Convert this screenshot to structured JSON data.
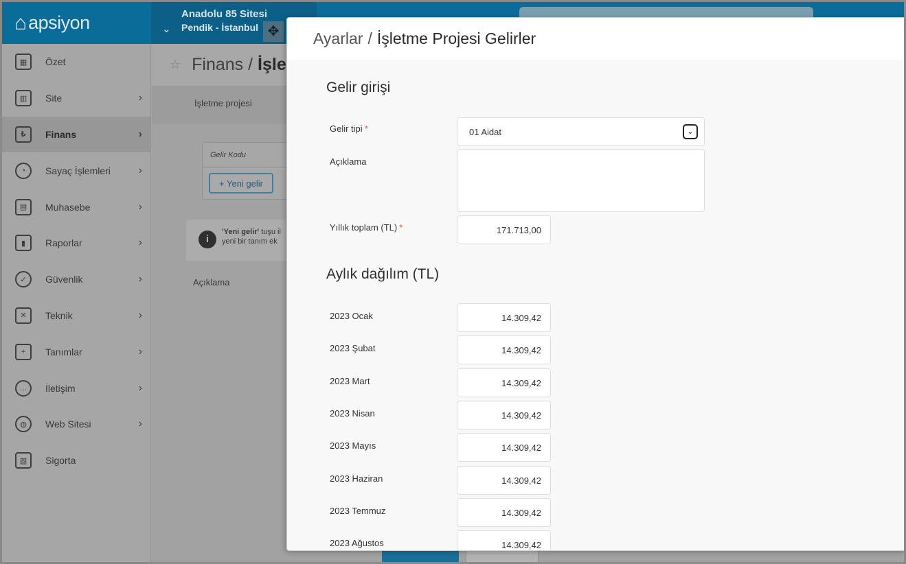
{
  "app": {
    "logo_text": "apsiyon",
    "site_name": "Anadolu 85 Sitesi",
    "site_location": "Pendik - İstanbul"
  },
  "sidebar": {
    "items": [
      {
        "label": "Özet",
        "icon": "layout-icon",
        "has_arrow": false
      },
      {
        "label": "Site",
        "icon": "building-icon",
        "has_arrow": true
      },
      {
        "label": "Finans",
        "icon": "money-icon",
        "has_arrow": true,
        "active": true
      },
      {
        "label": "Sayaç İşlemleri",
        "icon": "gauge-icon",
        "has_arrow": true
      },
      {
        "label": "Muhasebe",
        "icon": "briefcase-icon",
        "has_arrow": true
      },
      {
        "label": "Raporlar",
        "icon": "report-icon",
        "has_arrow": true
      },
      {
        "label": "Güvenlik",
        "icon": "shield-icon",
        "has_arrow": true
      },
      {
        "label": "Teknik",
        "icon": "tools-icon",
        "has_arrow": true
      },
      {
        "label": "Tanımlar",
        "icon": "grid-plus-icon",
        "has_arrow": true
      },
      {
        "label": "İletişim",
        "icon": "chat-icon",
        "has_arrow": true
      },
      {
        "label": "Web Sitesi",
        "icon": "globe-icon",
        "has_arrow": true
      },
      {
        "label": "Sigorta",
        "icon": "insurance-icon",
        "has_arrow": false
      }
    ]
  },
  "underlying": {
    "breadcrumb_root": "Finans",
    "breadcrumb_current": "İşlet",
    "tab_label": "İşletme projesi",
    "column_header": "Gelir Kodu",
    "new_button": "+ Yeni gelir",
    "info_bold": "'Yeni gelir'",
    "info_line1": " tuşu il",
    "info_line2": "yeni bir tanım ek",
    "desc_label": "Açıklama"
  },
  "modal": {
    "breadcrumb_root": "Ayarlar",
    "breadcrumb_sep": "/",
    "breadcrumb_current": "İşletme Projesi Gelirler",
    "section_income": "Gelir girişi",
    "income_type_label": "Gelir tipi",
    "income_type_value": "01 Aidat",
    "description_label": "Açıklama",
    "description_value": "",
    "annual_total_label": "Yıllık toplam (TL)",
    "annual_total_value": "171.713,00",
    "required_mark": "*",
    "section_monthly": "Aylık dağılım (TL)",
    "months": [
      {
        "label": "2023 Ocak",
        "value": "14.309,42"
      },
      {
        "label": "2023 Şubat",
        "value": "14.309,42"
      },
      {
        "label": "2023 Mart",
        "value": "14.309,42"
      },
      {
        "label": "2023 Nisan",
        "value": "14.309,42"
      },
      {
        "label": "2023 Mayıs",
        "value": "14.309,42"
      },
      {
        "label": "2023 Haziran",
        "value": "14.309,42"
      },
      {
        "label": "2023 Temmuz",
        "value": "14.309,42"
      },
      {
        "label": "2023 Ağustos",
        "value": "14.309,42"
      }
    ]
  }
}
